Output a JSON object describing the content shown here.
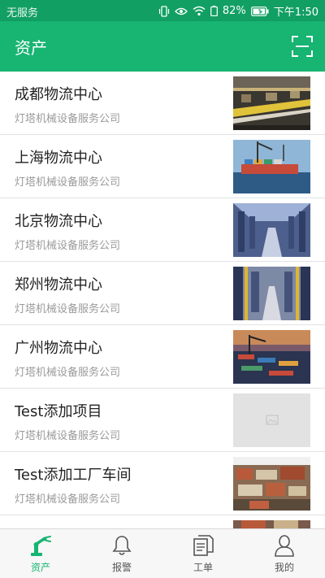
{
  "status_bar": {
    "carrier": "无服务",
    "battery": "82%",
    "time": "下午1:50"
  },
  "header": {
    "title": "资产",
    "scan_icon": "scan-icon"
  },
  "assets": [
    {
      "name": "成都物流中心",
      "company": "灯塔机械设备服务公司",
      "image": "warehouse-conveyor"
    },
    {
      "name": "上海物流中心",
      "company": "灯塔机械设备服务公司",
      "image": "container-port"
    },
    {
      "name": "北京物流中心",
      "company": "灯塔机械设备服务公司",
      "image": "warehouse-racks"
    },
    {
      "name": "郑州物流中心",
      "company": "灯塔机械设备服务公司",
      "image": "warehouse-aisle"
    },
    {
      "name": "广州物流中心",
      "company": "灯塔机械设备服务公司",
      "image": "port-night"
    },
    {
      "name": "Test添加项目",
      "company": "灯塔机械设备服务公司",
      "image": "placeholder"
    },
    {
      "name": "Test添加工厂车间",
      "company": "灯塔机械设备服务公司",
      "image": "city-rooftops"
    }
  ],
  "tabs": [
    {
      "label": "资产",
      "icon": "robot-arm-icon",
      "active": true
    },
    {
      "label": "报警",
      "icon": "bell-icon",
      "active": false
    },
    {
      "label": "工单",
      "icon": "document-icon",
      "active": false
    },
    {
      "label": "我的",
      "icon": "person-icon",
      "active": false
    }
  ],
  "colors": {
    "primary": "#17b472",
    "status_bar": "#129f63"
  }
}
